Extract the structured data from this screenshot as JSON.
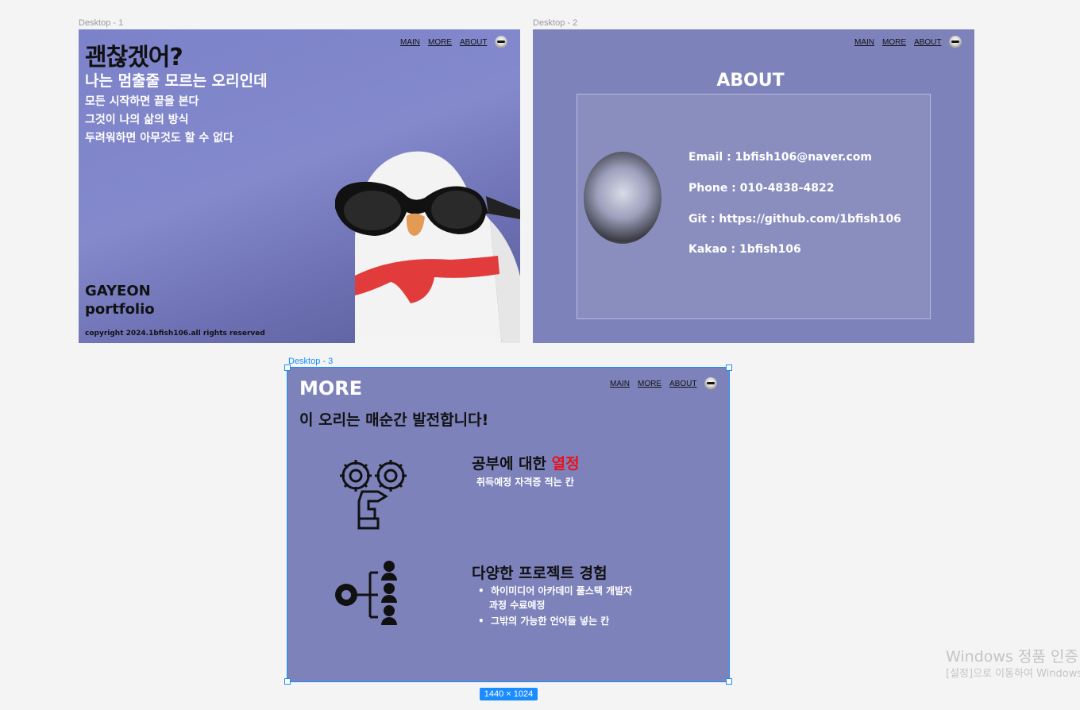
{
  "canvas": {
    "frames": [
      {
        "label": "Desktop - 1"
      },
      {
        "label": "Desktop - 2"
      },
      {
        "label": "Desktop - 3"
      }
    ],
    "selection_size": "1440 × 1024",
    "accent": "#1a8cff"
  },
  "nav": {
    "main": "MAIN",
    "more": "MORE",
    "about": "ABOUT"
  },
  "desktop1": {
    "title": "괜찮겠어?",
    "subtitle": "나는 멈출줄 모르는 오리인데",
    "lines": [
      "모든 시작하면 끝을 본다",
      "그것이 나의 삶의 방식",
      "두려워하면 아무것도 할 수 없다"
    ],
    "name_line1": "GAYEON",
    "name_line2": "portfolio",
    "copyright": "copyright 2024.1bfish106.all rights reserved",
    "background": "#8489cc"
  },
  "desktop2": {
    "title": "ABOUT",
    "contacts": [
      "Email : 1bfish106@naver.com",
      "Phone : 010-4838-4822",
      "Git : https://github.com/1bfish106",
      "Kakao : 1bfish106"
    ],
    "background": "#7d82bb"
  },
  "desktop3": {
    "title": "MORE",
    "subtitle": "이 오리는 매순간 발전합니다!",
    "section1": {
      "heading": "공부에 대한 ",
      "heading_highlight": "열정",
      "text": "취득예정 자격증 적는 칸",
      "icon": "gears-hand-icon"
    },
    "section2": {
      "heading": "다양한 프로젝트 경험",
      "bullets": [
        "하이미디어 아카데미 풀스택 개발자",
        "과정 수료예정",
        "그밖의 가능한 언어들 넣는 칸"
      ],
      "icon": "gear-people-icon"
    },
    "highlight_color": "#e8121c"
  },
  "watermark": {
    "line1": "Windows 정품 인증",
    "line2": "[설정]으로 이동하여 Windows"
  }
}
